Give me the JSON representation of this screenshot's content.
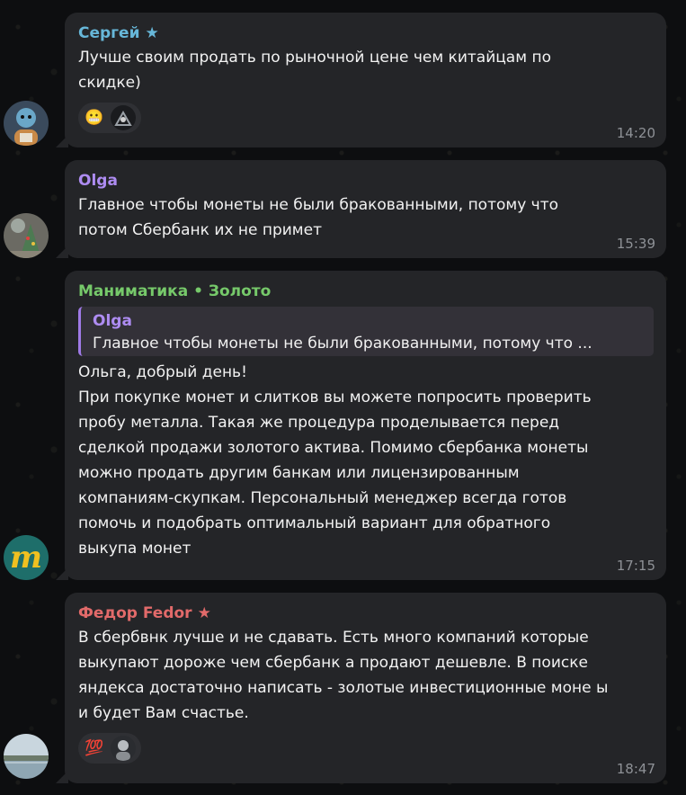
{
  "messages": [
    {
      "sender": "Сергей",
      "sender_color": "#67b7d9",
      "star": "★",
      "lines": [
        "Лучше своим продать по рыночной цене чем китайцам по",
        "скидке)"
      ],
      "reactions": {
        "emoji": "😬",
        "avatar_icon": "user-avatar-icon"
      },
      "time": "14:20",
      "avatar_icon": "user-avatar-icon"
    },
    {
      "sender": "Olga",
      "sender_color": "#ae8cf2",
      "lines": [
        "Главное чтобы монеты не были бракованными, потому что",
        "потом Сбербанк их не примет"
      ],
      "time": "15:39",
      "avatar_icon": "user-avatar-icon"
    },
    {
      "sender": "Маниматика • Золото",
      "sender_color": "#76c96a",
      "quote": {
        "author": "Olga",
        "text": "Главное чтобы монеты не были бракованными, потому что ..."
      },
      "lines": [
        "Ольга, добрый день!",
        "При покупке монет и слитков вы можете попросить проверить",
        "пробу металла. Такая же процедура проделывается перед",
        "сделкой продажи золотого актива. Помимо сбербанка монеты",
        "можно продать другим банкам или лицензированным",
        "компаниям-скупкам. Персональный менеджер всегда готов",
        "помочь и подобрать оптимальный вариант для обратного",
        "выкупа монет"
      ],
      "time": "17:15",
      "avatar_letter": "m",
      "avatar_icon": "channel-logo-icon"
    },
    {
      "sender": "Федор Fedor",
      "sender_color": "#e26a6a",
      "star": "★",
      "lines": [
        "В сбербвнк лучше и не сдавать. Есть много компаний которые",
        "выкупают дороже чем сбербанк а продают дешевле. В поиске",
        "яндекса достаточно написать - золотые инвестиционные моне ы",
        "и будет Вам счастье."
      ],
      "reactions": {
        "emoji": "💯",
        "avatar_icon": "user-avatar-icon"
      },
      "time": "18:47",
      "avatar_icon": "user-avatar-icon"
    }
  ]
}
